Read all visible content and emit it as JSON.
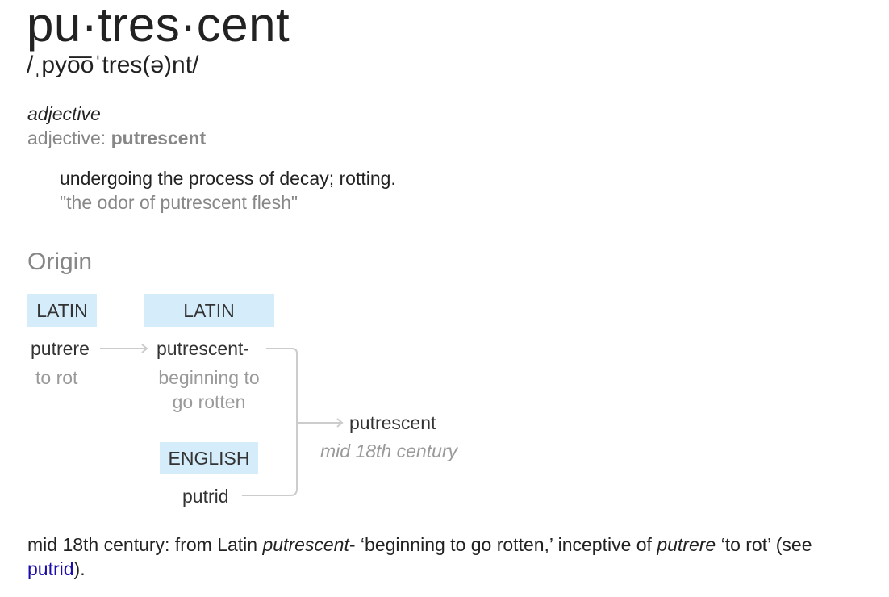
{
  "entry": {
    "headword": "pu·tres·cent",
    "pronunciation": "/ˌpyo͞oˈtres(ə)nt/",
    "part_of_speech": "adjective",
    "pos_label": "adjective:",
    "pos_word": "putrescent",
    "definition": "undergoing the process of decay; rotting.",
    "example": "\"the odor of putrescent flesh\""
  },
  "origin": {
    "heading": "Origin",
    "tags": {
      "latin1": "LATIN",
      "latin2": "LATIN",
      "english": "ENGLISH"
    },
    "nodes": {
      "putrere": "putrere",
      "putrere_gloss": "to rot",
      "putrescent_stem": "putrescent-",
      "putrescent_stem_gloss_1": "beginning to",
      "putrescent_stem_gloss_2": "go rotten",
      "putrid": "putrid",
      "result": "putrescent",
      "result_date": "mid 18th century"
    }
  },
  "etymology": {
    "text_1": "mid 18th century: from Latin ",
    "italic_1": "putrescent",
    "text_2": "- ‘beginning to go rotten,’ inceptive of ",
    "italic_2": "putrere",
    "text_3": " ‘to rot’ (see ",
    "link": "putrid",
    "text_4": ")."
  },
  "colors": {
    "tag_bg": "#d5ecfb",
    "gray": "#878787",
    "link": "#1a0dab",
    "connector": "#cccccc"
  }
}
